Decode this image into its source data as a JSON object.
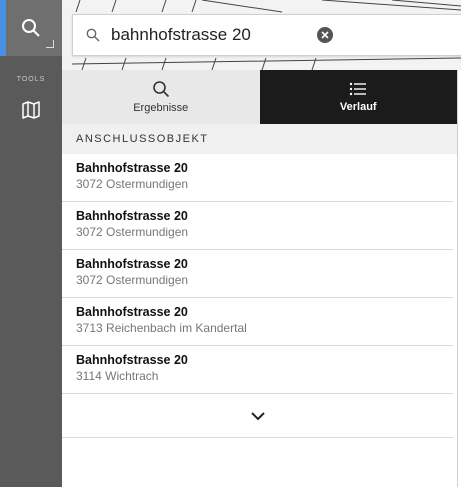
{
  "search": {
    "value": "bahnhofstrasse 20",
    "icon": "search-icon"
  },
  "sidebar": {
    "tools_label": "TOOLS"
  },
  "tabs": [
    {
      "label": "Ergebnisse",
      "icon": "search-icon",
      "active": true
    },
    {
      "label": "Verlauf",
      "icon": "list-icon",
      "active": false
    }
  ],
  "section": {
    "title": "ANSCHLUSSOBJEKT"
  },
  "results": [
    {
      "title": "Bahnhofstrasse 20",
      "subtitle": "3072 Ostermundigen"
    },
    {
      "title": "Bahnhofstrasse 20",
      "subtitle": "3072 Ostermundigen"
    },
    {
      "title": "Bahnhofstrasse 20",
      "subtitle": "3072 Ostermundigen"
    },
    {
      "title": "Bahnhofstrasse 20",
      "subtitle": "3713 Reichenbach im Kandertal"
    },
    {
      "title": "Bahnhofstrasse 20",
      "subtitle": "3114 Wichtrach"
    }
  ],
  "colors": {
    "sidebar": "#5a5a5a",
    "accent": "#4a90e2",
    "active_tab": "#1b1b1b"
  }
}
